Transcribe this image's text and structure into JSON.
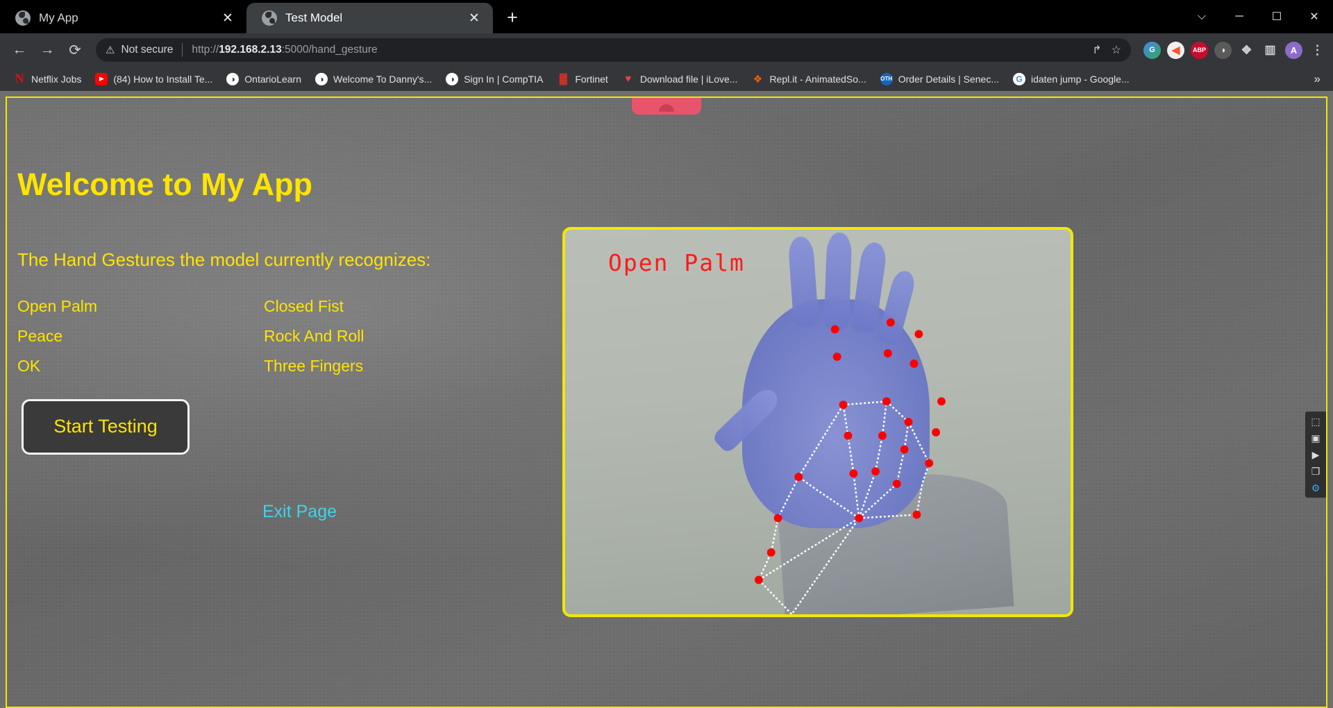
{
  "browser": {
    "tabs": [
      {
        "title": "My App",
        "active": false,
        "favicon": "globe-icon",
        "close_label": "✕"
      },
      {
        "title": "Test Model",
        "active": true,
        "favicon": "globe-icon",
        "close_label": "✕"
      }
    ],
    "new_tab_label": "+",
    "window_controls": {
      "history": "⌵",
      "minimize": "─",
      "maximize": "☐",
      "close": "✕"
    },
    "nav": {
      "back": "←",
      "forward": "→",
      "reload": "⟳"
    },
    "omnibox": {
      "warning_icon": "⚠",
      "security_text": "Not secure",
      "url_scheme": "http://",
      "url_host": "192.168.2.13",
      "url_rest": ":5000/hand_gesture",
      "share_icon": "↱",
      "bookmark_icon": "☆"
    },
    "extensions": [
      {
        "name": "grammarly-extension-icon",
        "glyph": "G",
        "cls": "g"
      },
      {
        "name": "brave-extension-icon",
        "glyph": "◀",
        "cls": "brave"
      },
      {
        "name": "adblock-plus-extension-icon",
        "glyph": "ABP",
        "cls": "abp"
      },
      {
        "name": "mask-extension-icon",
        "glyph": "◑",
        "cls": "mask"
      },
      {
        "name": "extensions-puzzle-icon",
        "glyph": "❖",
        "cls": "puzzle"
      },
      {
        "name": "side-panel-icon",
        "glyph": "▥",
        "cls": "panel"
      },
      {
        "name": "profile-avatar",
        "glyph": "A",
        "cls": "avatar"
      },
      {
        "name": "chrome-menu-icon",
        "glyph": "⋮",
        "cls": "kebab"
      }
    ],
    "bookmarks": [
      {
        "label": "Netflix Jobs",
        "icon": "netflix-icon",
        "cls": "ico-netflix",
        "glyph": "N"
      },
      {
        "label": "(84) How to Install Te...",
        "icon": "youtube-icon",
        "cls": "ico-youtube",
        "glyph": "▶"
      },
      {
        "label": "OntarioLearn",
        "icon": "globe-icon",
        "cls": "ico-globe",
        "glyph": "◑"
      },
      {
        "label": "Welcome To Danny's...",
        "icon": "globe-icon",
        "cls": "ico-globe",
        "glyph": "◑"
      },
      {
        "label": "Sign In | CompTIA",
        "icon": "globe-icon",
        "cls": "ico-globe",
        "glyph": "◑"
      },
      {
        "label": "Fortinet",
        "icon": "fortinet-icon",
        "cls": "ico-fortinet",
        "glyph": "▓"
      },
      {
        "label": "Download file | iLove...",
        "icon": "heart-icon",
        "cls": "ico-heart",
        "glyph": "♥"
      },
      {
        "label": "Repl.it - AnimatedSo...",
        "icon": "replit-icon",
        "cls": "ico-replit",
        "glyph": "❖"
      },
      {
        "label": "Order Details | Senec...",
        "icon": "othello-icon",
        "cls": "ico-oth",
        "glyph": "OTH"
      },
      {
        "label": "idaten jump - Google...",
        "icon": "google-icon",
        "cls": "ico-google",
        "glyph": "G"
      }
    ],
    "bookmarks_overflow_label": "»"
  },
  "page": {
    "hero_title": "Welcome to My App",
    "subtitle": "The Hand Gestures the model currently recognizes:",
    "gestures": [
      "Open Palm",
      "Closed Fist",
      "Peace",
      "Rock And Roll",
      "OK",
      "Three Fingers"
    ],
    "start_button_label": "Start Testing",
    "exit_link_label": "Exit Page",
    "video": {
      "prediction_label": "Open Palm",
      "border_color": "#f2e800",
      "landmark_color": "#ff0000",
      "connection_color": "#ffffff"
    },
    "colors": {
      "accent_yellow": "#ffe400",
      "link_cyan": "#3fd4e8",
      "prediction_red": "#ff1a1a"
    }
  },
  "capture_toolbar": [
    {
      "name": "screenshot-icon",
      "glyph": "⬚"
    },
    {
      "name": "camera-icon",
      "glyph": "▣"
    },
    {
      "name": "video-icon",
      "glyph": "▶"
    },
    {
      "name": "window-copy-icon",
      "glyph": "❐"
    },
    {
      "name": "gear-icon",
      "glyph": "⚙"
    }
  ]
}
